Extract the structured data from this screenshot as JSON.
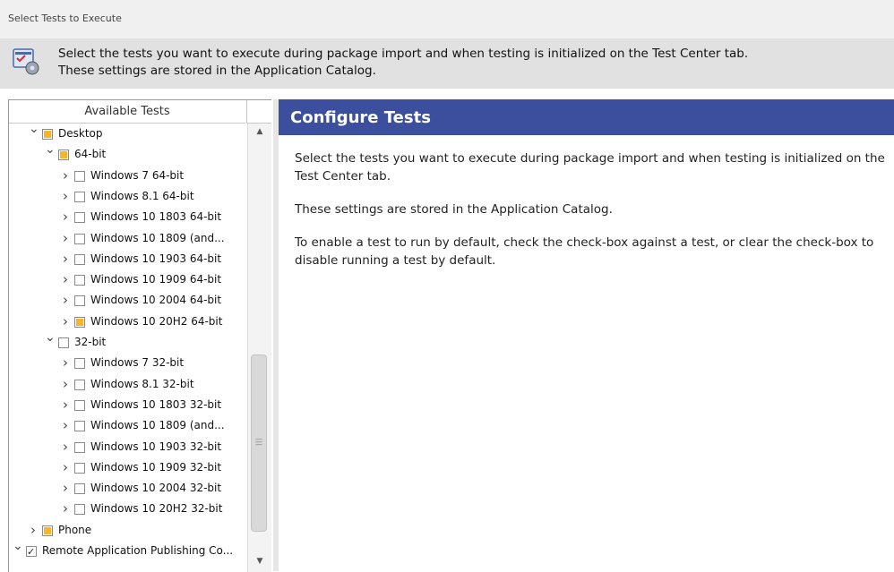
{
  "window": {
    "title": "Select Tests to Execute"
  },
  "header": {
    "icon": "test-settings-icon",
    "line1": "Select the tests you want to execute during package import and when testing is initialized on the Test Center tab.",
    "line2": "These settings are stored in the Application Catalog."
  },
  "tree": {
    "header": "Available Tests",
    "rows": [
      {
        "label": "Desktop",
        "expanded": true,
        "state": "partial",
        "level": 1
      },
      {
        "label": "64-bit",
        "expanded": true,
        "state": "partial",
        "level": 2
      },
      {
        "label": "Windows 7 64-bit",
        "expanded": false,
        "state": "unchecked",
        "level": 3
      },
      {
        "label": "Windows 8.1 64-bit",
        "expanded": false,
        "state": "unchecked",
        "level": 3
      },
      {
        "label": "Windows 10 1803 64-bit",
        "expanded": false,
        "state": "unchecked",
        "level": 3
      },
      {
        "label": "Windows 10 1809 (and...",
        "expanded": false,
        "state": "unchecked",
        "level": 3
      },
      {
        "label": "Windows 10 1903 64-bit",
        "expanded": false,
        "state": "unchecked",
        "level": 3
      },
      {
        "label": "Windows 10 1909 64-bit",
        "expanded": false,
        "state": "unchecked",
        "level": 3
      },
      {
        "label": "Windows 10 2004 64-bit",
        "expanded": false,
        "state": "unchecked",
        "level": 3
      },
      {
        "label": "Windows 10 20H2 64-bit",
        "expanded": false,
        "state": "partial",
        "level": 3
      },
      {
        "label": "32-bit",
        "expanded": true,
        "state": "unchecked",
        "level": 2
      },
      {
        "label": "Windows 7 32-bit",
        "expanded": false,
        "state": "unchecked",
        "level": 3
      },
      {
        "label": "Windows 8.1 32-bit",
        "expanded": false,
        "state": "unchecked",
        "level": 3
      },
      {
        "label": "Windows 10 1803 32-bit",
        "expanded": false,
        "state": "unchecked",
        "level": 3
      },
      {
        "label": "Windows 10 1809 (and...",
        "expanded": false,
        "state": "unchecked",
        "level": 3
      },
      {
        "label": "Windows 10 1903 32-bit",
        "expanded": false,
        "state": "unchecked",
        "level": 3
      },
      {
        "label": "Windows 10 1909 32-bit",
        "expanded": false,
        "state": "unchecked",
        "level": 3
      },
      {
        "label": "Windows 10 2004 32-bit",
        "expanded": false,
        "state": "unchecked",
        "level": 3
      },
      {
        "label": "Windows 10 20H2 32-bit",
        "expanded": false,
        "state": "unchecked",
        "level": 3
      },
      {
        "label": "Phone",
        "expanded": false,
        "state": "partial",
        "level": 1
      },
      {
        "label": "Remote Application Publishing Co...",
        "expanded": true,
        "state": "checked",
        "level": 0
      }
    ]
  },
  "config": {
    "title": "Configure Tests",
    "para1": "Select the tests you want to execute during package import and when testing is initialized on the Test Center tab.",
    "para2": "These settings are stored in the Application Catalog.",
    "para3": "To enable a test to run by default, check the check-box against a test, or clear the check-box to disable running a test by default."
  },
  "colors": {
    "title_bar": "#3c4f9e",
    "partial_check": "#f7b62a"
  }
}
